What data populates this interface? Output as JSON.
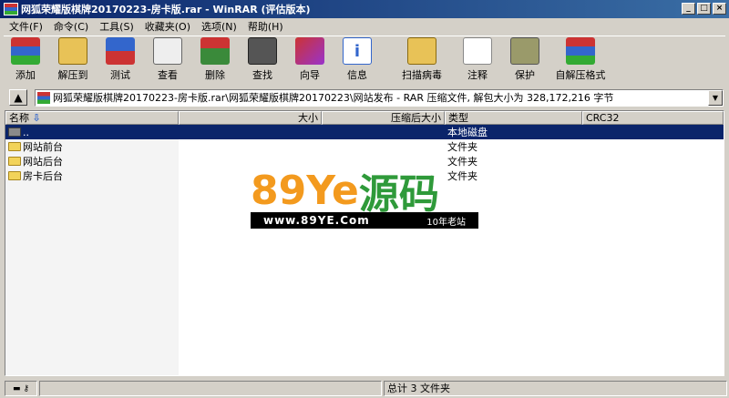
{
  "window": {
    "title": "网狐荣耀版棋牌20170223-房卡版.rar - WinRAR (评估版本)",
    "minimize": "_",
    "maximize": "□",
    "close": "×"
  },
  "menu": [
    "文件(F)",
    "命令(C)",
    "工具(S)",
    "收藏夹(O)",
    "选项(N)",
    "帮助(H)"
  ],
  "toolbar": [
    {
      "label": "添加",
      "icon": "add-archive-icon"
    },
    {
      "label": "解压到",
      "icon": "extract-to-icon"
    },
    {
      "label": "测试",
      "icon": "test-icon"
    },
    {
      "label": "查看",
      "icon": "view-icon"
    },
    {
      "label": "删除",
      "icon": "delete-icon"
    },
    {
      "label": "查找",
      "icon": "find-icon"
    },
    {
      "label": "向导",
      "icon": "wizard-icon"
    },
    {
      "label": "信息",
      "icon": "info-icon"
    },
    {
      "label": "扫描病毒",
      "icon": "virus-scan-icon"
    },
    {
      "label": "注释",
      "icon": "comment-icon"
    },
    {
      "label": "保护",
      "icon": "protect-icon"
    },
    {
      "label": "自解压格式",
      "icon": "sfx-icon"
    }
  ],
  "address": {
    "text": "网狐荣耀版棋牌20170223-房卡版.rar\\网狐荣耀版棋牌20170223\\网站发布 - RAR 压缩文件, 解包大小为 328,172,216 字节"
  },
  "columns": [
    "名称",
    "大小",
    "压缩后大小",
    "类型",
    "CRC32"
  ],
  "sort_arrow": "⇩",
  "rows": [
    {
      "name": "..",
      "type": "本地磁盘",
      "kind": "drive"
    },
    {
      "name": "网站前台",
      "type": "文件夹",
      "kind": "folder"
    },
    {
      "name": "网站后台",
      "type": "文件夹",
      "kind": "folder"
    },
    {
      "name": "房卡后台",
      "type": "文件夹",
      "kind": "folder"
    }
  ],
  "watermark": {
    "logo_a": "89",
    "logo_b": "Ye",
    "logo_c": "源码",
    "url": "www.89YE.Com",
    "slogan": "10年老站"
  },
  "status": {
    "summary": "总计 3 文件夹"
  },
  "colors": {
    "title_bar": "#0a246a",
    "selection": "#0a246a",
    "logo_orange": "#f39a1e",
    "logo_green": "#2f9a3a"
  }
}
